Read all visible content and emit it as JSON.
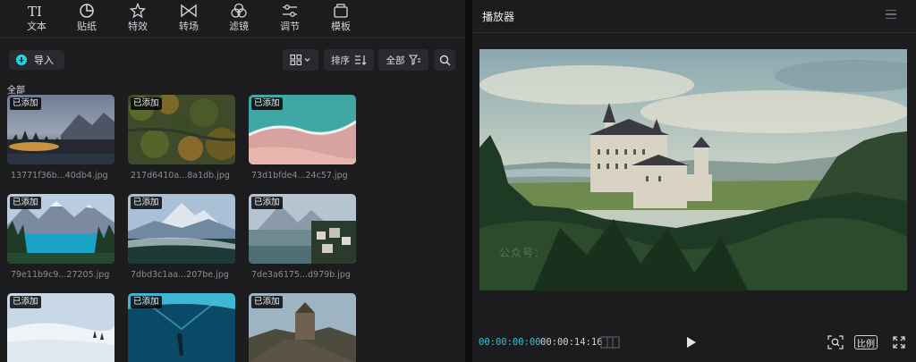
{
  "toolbar": {
    "items": [
      {
        "label": "文本",
        "icon": "text-icon"
      },
      {
        "label": "贴纸",
        "icon": "sticker-icon"
      },
      {
        "label": "特效",
        "icon": "effects-icon"
      },
      {
        "label": "转场",
        "icon": "transition-icon"
      },
      {
        "label": "滤镜",
        "icon": "filter-icon"
      },
      {
        "label": "调节",
        "icon": "adjust-icon"
      },
      {
        "label": "模板",
        "icon": "template-icon"
      }
    ]
  },
  "media": {
    "import_label": "导入",
    "sort_label": "排序",
    "filter_label": "全部",
    "section_label": "全部",
    "badge_label": "已添加",
    "items": [
      {
        "name": "13771f36b...40db4.jpg",
        "badge": "已添加"
      },
      {
        "name": "217d6410a...8a1db.jpg",
        "badge": "已添加"
      },
      {
        "name": "73d1bfde4...24c57.jpg",
        "badge": "已添加"
      },
      {
        "name": "79e11b9c9...27205.jpg",
        "badge": "已添加"
      },
      {
        "name": "7dbd3c1aa...207be.jpg",
        "badge": "已添加"
      },
      {
        "name": "7de3a6175...d979b.jpg",
        "badge": "已添加"
      },
      {
        "name": "",
        "badge": "已添加"
      },
      {
        "name": "",
        "badge": "已添加"
      },
      {
        "name": "",
        "badge": "已添加"
      }
    ]
  },
  "player": {
    "title": "播放器",
    "watermark": "公众号：",
    "current_time": "00:00:00:00",
    "total_time": "00:00:14:16",
    "ratio_label": "比例"
  },
  "colors": {
    "accent": "#1fc7d8",
    "panel": "#1c1c1f",
    "background": "#0e0e10"
  }
}
